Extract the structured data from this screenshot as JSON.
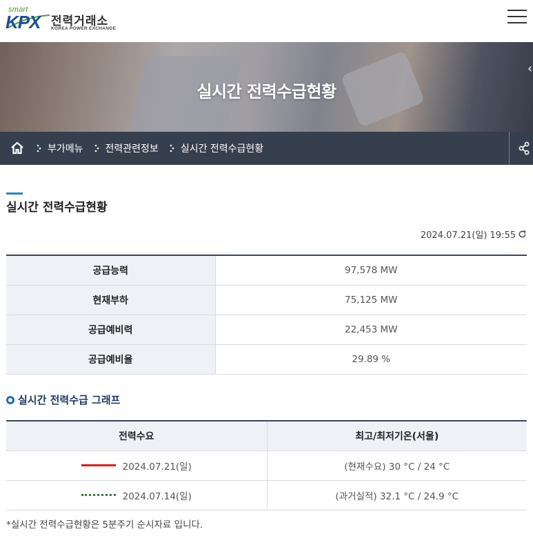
{
  "header": {
    "logo_smart": "smart",
    "logo_kpx": "KPX",
    "logo_korean": "전력거래소",
    "logo_english": "KOREA POWER EXCHANGE"
  },
  "banner": {
    "title": "실시간 전력수급현황"
  },
  "breadcrumb": {
    "items": [
      "부가메뉴",
      "전력관련정보",
      "실시간 전력수급현황"
    ]
  },
  "page": {
    "title": "실시간 전력수급현황",
    "timestamp": "2024.07.21(일) 19:55"
  },
  "supply_table": {
    "rows": [
      {
        "label": "공급능력",
        "value": "97,578 MW"
      },
      {
        "label": "현재부하",
        "value": "75,125 MW"
      },
      {
        "label": "공급예비력",
        "value": "22,453 MW"
      },
      {
        "label": "공급예비율",
        "value": "29.89 %"
      }
    ]
  },
  "graph": {
    "title": "실시간 전력수급 그래프",
    "col1_header": "전력수요",
    "col2_header": "최고/최저기온(서울)",
    "rows": [
      {
        "date": "2024.07.21(일)",
        "temp": "(현재수요) 30 °C / 24 °C",
        "line_style": "solid",
        "line_color": "#e21a1a"
      },
      {
        "date": "2024.07.14(일)",
        "temp": "(과거실적) 32.1 °C / 24.9 °C",
        "line_style": "dotted",
        "line_color": "#1f8a2a"
      }
    ]
  },
  "footnote": "*실시간 전력수급현황은 5분주기 순시자료 입니다."
}
